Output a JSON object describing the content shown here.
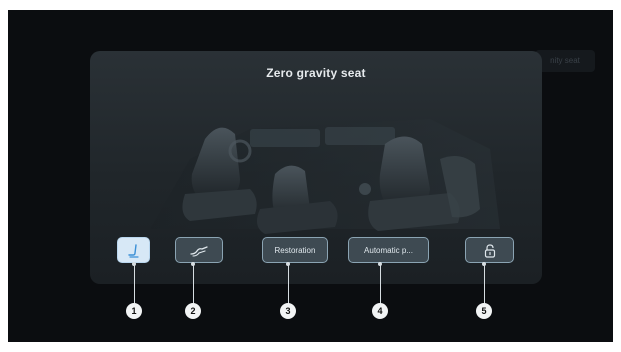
{
  "background": {
    "partial_label": "nity seat"
  },
  "modal": {
    "title": "Zero gravity seat"
  },
  "buttons": [
    {
      "id": "seat-posture",
      "label": "",
      "icon": "seat-recline-icon",
      "active": true
    },
    {
      "id": "leg-rest",
      "label": "",
      "icon": "leg-rest-icon",
      "active": false
    },
    {
      "id": "restoration",
      "label": "Restoration",
      "icon": "",
      "active": false
    },
    {
      "id": "automatic",
      "label": "Automatic p...",
      "icon": "",
      "active": false
    },
    {
      "id": "lock",
      "label": "",
      "icon": "lock-icon",
      "active": false
    }
  ],
  "callouts": [
    "1",
    "2",
    "3",
    "4",
    "5"
  ],
  "colors": {
    "accent_active": "#d7e8f6",
    "button_border": "#8ba4b3",
    "modal_bg": "#252c31"
  }
}
